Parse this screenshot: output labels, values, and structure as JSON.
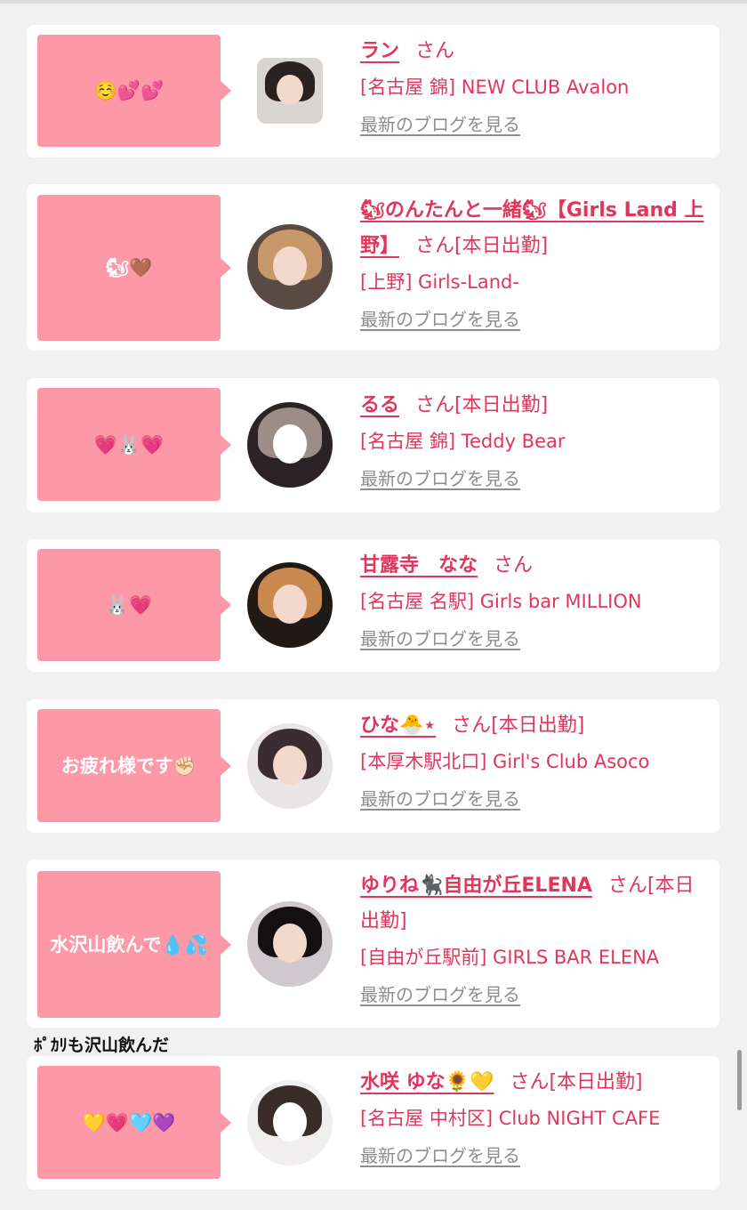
{
  "cards": [
    {
      "bubble_text": "☺️💕💕",
      "name": "ラン",
      "suffix": "さん",
      "status": "",
      "shop": "[名古屋 錦] NEW CLUB Avalon",
      "blog_link": "最新のブログを見る",
      "avatar_style": "square",
      "avatar_colors": [
        "#d9d5d2",
        "#2a2220"
      ]
    },
    {
      "bubble_text": "🐿🤎",
      "name": "🐿のんたんと一緒🐿【Girls Land 上野】",
      "suffix": "さん",
      "status": "[本日出勤]",
      "shop": "[上野] Girls-Land-",
      "blog_link": "最新のブログを見る",
      "avatar_style": "circle",
      "avatar_colors": [
        "#5a4a44",
        "#c9986a"
      ]
    },
    {
      "bubble_text": "💗🐰💗",
      "name": "るる",
      "suffix": "さん",
      "status": "[本日出勤]",
      "shop": "[名古屋 錦] Teddy Bear",
      "blog_link": "最新のブログを見る",
      "avatar_style": "circle",
      "avatar_colors": [
        "#2b2226",
        "#9c8e87"
      ]
    },
    {
      "bubble_text": "🐰💗",
      "name": "甘露寺　なな",
      "suffix": "さん",
      "status": "",
      "shop": "[名古屋 名駅] Girls bar MILLION",
      "blog_link": "最新のブログを見る",
      "avatar_style": "circle",
      "avatar_colors": [
        "#1f1a16",
        "#c8884e"
      ]
    },
    {
      "bubble_text": "お疲れ様です✊🏻",
      "name": "ひな🐣⋆",
      "suffix": "さん",
      "status": "[本日出勤]",
      "shop": "[本厚木駅北口] Girl's Club Asoco",
      "blog_link": "最新のブログを見る",
      "avatar_style": "circle",
      "avatar_colors": [
        "#e9e4e6",
        "#3a2c30"
      ]
    },
    {
      "bubble_text": "水沢山飲んで💧💦",
      "name": "ゆりね🐈‍⬛自由が丘ELENA",
      "suffix": "さん",
      "status": "[本日出勤]",
      "shop": "[自由が丘駅前] GIRLS BAR ELENA",
      "blog_link": "最新のブログを見る",
      "avatar_style": "circle",
      "avatar_colors": [
        "#cfc8cc",
        "#141012"
      ]
    },
    {
      "bubble_text": "💛💗🩵💜",
      "name": "水咲 ゆな🌻💛",
      "suffix": "さん",
      "status": "[本日出勤]",
      "shop": "[名古屋 中村区] Club NIGHT CAFE",
      "blog_link": "最新のブログを見る",
      "avatar_style": "circle",
      "avatar_colors": [
        "#f0eeee",
        "#3a2c2a"
      ]
    }
  ],
  "overflow_text": "ﾎﾟｶﾘも沢山飲んだ"
}
